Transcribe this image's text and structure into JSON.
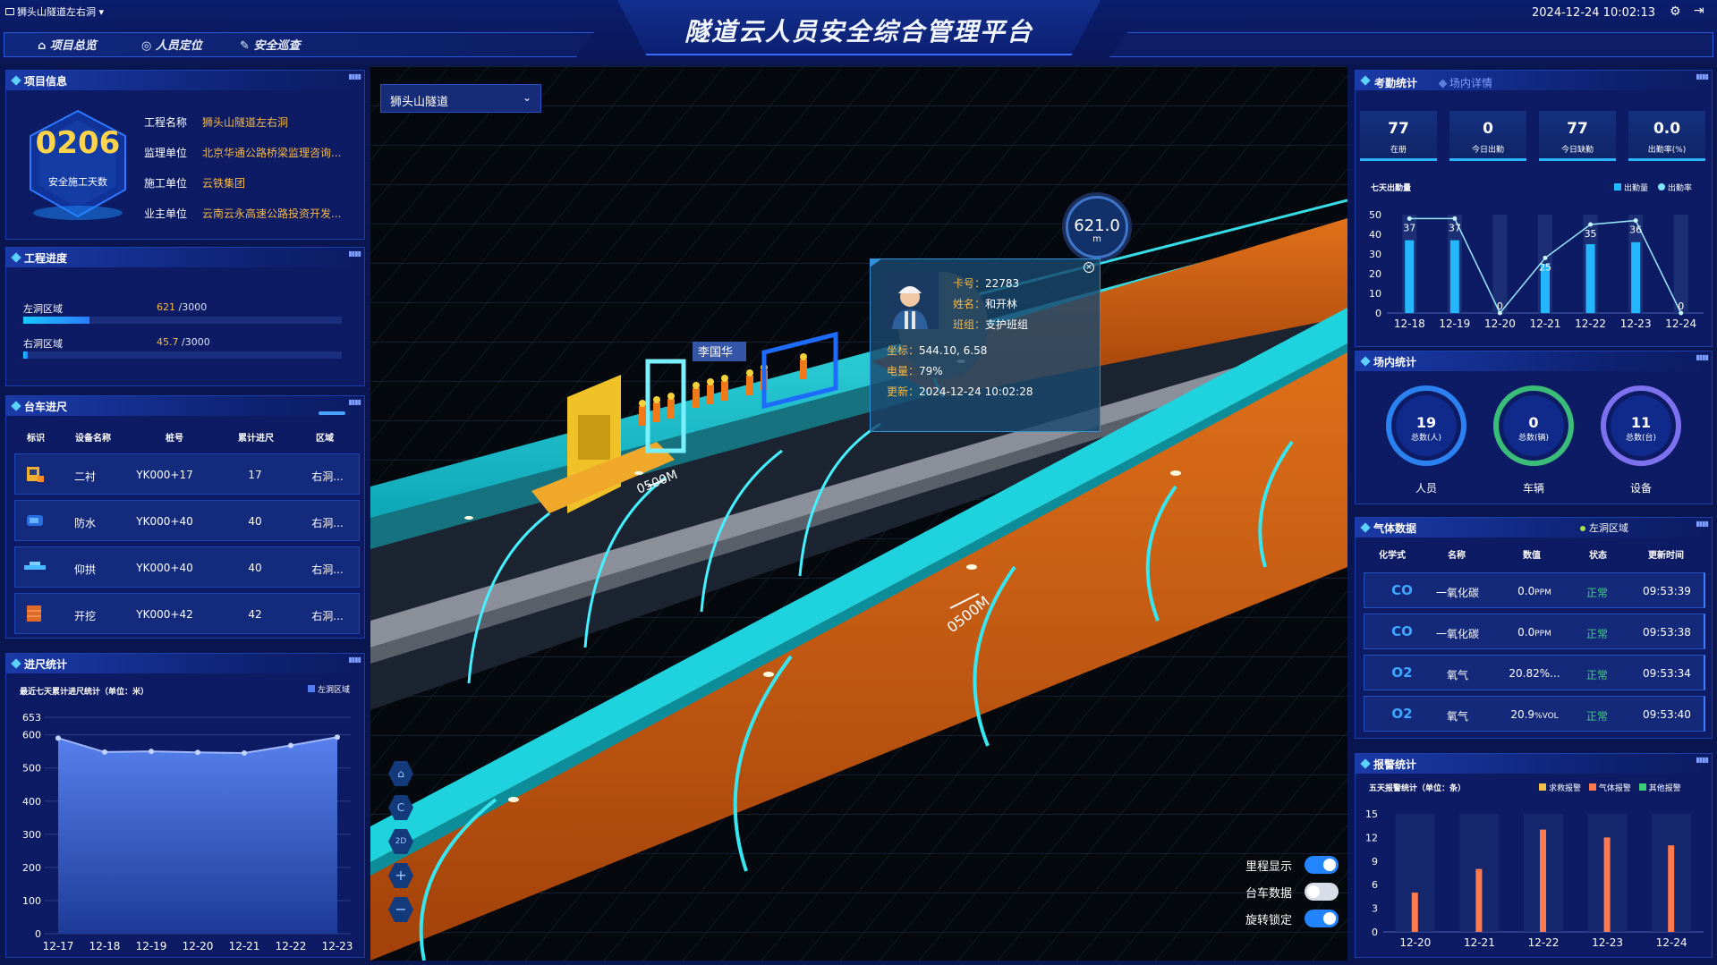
{
  "header": {
    "project_selector": "狮头山隧道左右洞",
    "title": "隧道云人员安全综合管理平台",
    "datetime": "2024-12-24 10:02:13",
    "nav": [
      "项目总览",
      "人员定位",
      "安全巡查"
    ]
  },
  "project_info": {
    "title": "项目信息",
    "days": "0206",
    "days_label": "安全施工天数",
    "rows": [
      {
        "k": "工程名称",
        "v": "狮头山隧道左右洞"
      },
      {
        "k": "监理单位",
        "v": "北京华通公路桥梁监理咨询..."
      },
      {
        "k": "施工单位",
        "v": "云铁集团"
      },
      {
        "k": "业主单位",
        "v": "云南云永高速公路投资开发..."
      }
    ]
  },
  "progress": {
    "title": "工程进度",
    "items": [
      {
        "label": "左洞区域",
        "value": "621",
        "total": "/3000",
        "fraction": 0.207
      },
      {
        "label": "右洞区域",
        "value": "45.7",
        "total": "/3000",
        "fraction": 0.015
      }
    ]
  },
  "trolley": {
    "title": "台车进尺",
    "headers": [
      "标识",
      "设备名称",
      "桩号",
      "累计进尺",
      "区域"
    ],
    "rows": [
      {
        "name": "二衬",
        "pile": "YK000+17",
        "total": "17",
        "area": "右洞..."
      },
      {
        "name": "防水",
        "pile": "YK000+40",
        "total": "40",
        "area": "右洞..."
      },
      {
        "name": "仰拱",
        "pile": "YK000+40",
        "total": "40",
        "area": "右洞..."
      },
      {
        "name": "开挖",
        "pile": "YK000+42",
        "total": "42",
        "area": "右洞..."
      }
    ]
  },
  "advance_stats": {
    "title": "进尺统计",
    "subtitle": "最近七天累计进尺统计（单位：米）",
    "legend": "左洞区域",
    "ymax_label": "653",
    "yticks": [
      "600",
      "500",
      "400",
      "300",
      "200",
      "100",
      "0"
    ]
  },
  "scene": {
    "tunnel_select": "狮头山隧道",
    "mileage": "621.0",
    "mileage_unit": "m",
    "markers": [
      "0500M",
      "0500M"
    ],
    "worker_tag": "李国华",
    "popup": {
      "card_label": "卡号：",
      "card": "22783",
      "name_label": "姓名：",
      "name": "和开林",
      "team_label": "班组：",
      "team": "支护班组",
      "coord_label": "坐标：",
      "coord": "544.10, 6.58",
      "battery_label": "电量：",
      "battery": "79%",
      "update_label": "更新：",
      "update": "2024-12-24 10:02:28"
    },
    "controls": [
      "2D"
    ],
    "toggles": [
      {
        "label": "里程显示",
        "on": true
      },
      {
        "label": "台车数据",
        "on": false
      },
      {
        "label": "旋转锁定",
        "on": true
      }
    ]
  },
  "attendance": {
    "tab_active": "考勤统计",
    "tab_other": "场内详情",
    "stats": [
      {
        "n": "77",
        "l": "在册"
      },
      {
        "n": "0",
        "l": "今日出勤"
      },
      {
        "n": "77",
        "l": "今日缺勤"
      },
      {
        "n": "0.0",
        "l": "出勤率(%)"
      }
    ],
    "chart_title": "七天出勤量",
    "legend": [
      "出勤量",
      "出勤率"
    ]
  },
  "onsite": {
    "title": "场内统计",
    "items": [
      {
        "n": "19",
        "sub": "总数(人)",
        "label": "人员",
        "color": "#2f8dff"
      },
      {
        "n": "0",
        "sub": "总数(辆)",
        "label": "车辆",
        "color": "#3ecf7a"
      },
      {
        "n": "11",
        "sub": "总数(台)",
        "label": "设备",
        "color": "#8a7bff"
      }
    ]
  },
  "gas": {
    "title": "气体数据",
    "area": "左洞区域",
    "headers": [
      "化学式",
      "名称",
      "数值",
      "状态",
      "更新时间"
    ],
    "rows": [
      {
        "f": "CO",
        "name": "一氧化碳",
        "val": "0.0",
        "unit": "PPM",
        "status": "正常",
        "time": "09:53:39"
      },
      {
        "f": "CO",
        "name": "一氧化碳",
        "val": "0.0",
        "unit": "PPM",
        "status": "正常",
        "time": "09:53:38"
      },
      {
        "f": "O2",
        "name": "氧气",
        "val": "20.82%...",
        "unit": "",
        "status": "正常",
        "time": "09:53:34"
      },
      {
        "f": "O2",
        "name": "氧气",
        "val": "20.9",
        "unit": "%VOL",
        "status": "正常",
        "time": "09:53:40"
      }
    ]
  },
  "alarm": {
    "title": "报警统计",
    "subtitle": "五天报警统计（单位：条）",
    "legend": [
      "求救报警",
      "气体报警",
      "其他报警"
    ]
  },
  "chart_data": [
    {
      "type": "area",
      "title": "最近七天累计进尺统计（单位：米）",
      "categories": [
        "12-17",
        "12-18",
        "12-19",
        "12-20",
        "12-21",
        "12-22",
        "12-23"
      ],
      "series": [
        {
          "name": "左洞区域",
          "values": [
            590,
            548,
            550,
            547,
            545,
            568,
            593
          ]
        }
      ],
      "ylim": [
        0,
        653
      ],
      "color": "#4f7cf0"
    },
    {
      "type": "bar",
      "title": "七天出勤量",
      "categories": [
        "12-18",
        "12-19",
        "12-20",
        "12-21",
        "12-22",
        "12-23",
        "12-24"
      ],
      "series": [
        {
          "name": "出勤量",
          "values": [
            37,
            37,
            0,
            25,
            35,
            36,
            0
          ]
        },
        {
          "name": "出勤率",
          "values": [
            48,
            48,
            0,
            28,
            45,
            47,
            0
          ]
        }
      ],
      "labels": [
        "37",
        "37",
        "0",
        "25",
        "35",
        "36",
        "0"
      ],
      "ylim": [
        0,
        50
      ],
      "yticks": [
        0,
        10,
        20,
        30,
        40,
        50
      ]
    },
    {
      "type": "bar",
      "title": "五天报警统计（单位：条）",
      "categories": [
        "12-20",
        "12-21",
        "12-22",
        "12-23",
        "12-24"
      ],
      "series": [
        {
          "name": "求救报警",
          "values": [
            0,
            0,
            0,
            0,
            0
          ]
        },
        {
          "name": "气体报警",
          "values": [
            5,
            8,
            13,
            12,
            11
          ]
        },
        {
          "name": "其他报警",
          "values": [
            0,
            0,
            0,
            0,
            0
          ]
        }
      ],
      "ylim": [
        0,
        15
      ],
      "yticks": [
        0,
        3,
        6,
        9,
        12,
        15
      ]
    }
  ],
  "colors": {
    "accent": "#2cb5ff",
    "bg": "#0a1650",
    "orange": "#f5b94a",
    "normal": "#3ecf7a"
  }
}
